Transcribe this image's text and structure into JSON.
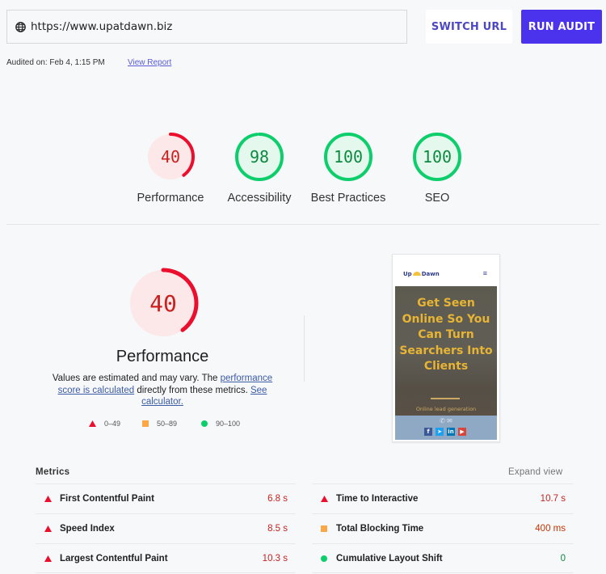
{
  "toolbar": {
    "url_value": "https://www.upatdawn.biz",
    "url_icon": "globe-icon",
    "switch_url_label": "SWITCH URL",
    "run_audit_label": "RUN AUDIT"
  },
  "audit_info": {
    "audited_on": "Audited on: Feb 4, 1:15 PM",
    "view_report_label": "View Report"
  },
  "colors": {
    "accent": "#4b33ee",
    "fail": "#eb0f2d",
    "average": "#fca746",
    "pass": "#0cce6b"
  },
  "categories": [
    {
      "label": "Performance",
      "score": 40,
      "status": "fail"
    },
    {
      "label": "Accessibility",
      "score": 98,
      "status": "pass"
    },
    {
      "label": "Best Practices",
      "score": 100,
      "status": "pass"
    },
    {
      "label": "SEO",
      "score": 100,
      "status": "pass"
    }
  ],
  "performance": {
    "score": 40,
    "title": "Performance",
    "desc_prefix": "Values are estimated and may vary. The ",
    "desc_link1": "performance score is calculated",
    "desc_middle": " directly from these metrics. ",
    "desc_link2": "See calculator.",
    "legend": [
      {
        "shape": "triangle",
        "range": "0–49"
      },
      {
        "shape": "square",
        "range": "50–89"
      },
      {
        "shape": "circle",
        "range": "90–100"
      }
    ]
  },
  "preview": {
    "logo_text_left": "Up",
    "logo_text_right": "Dawn",
    "menu_icon": "hamburger-icon",
    "headline": "Get Seen Online So You Can Turn Searchers Into Clients",
    "subheadline": "Online lead generation",
    "social": [
      "f",
      "t",
      "in",
      "yt"
    ]
  },
  "metrics": {
    "title": "Metrics",
    "expand_label": "Expand view",
    "left": [
      {
        "name": "First Contentful Paint",
        "value": "6.8 s",
        "status": "fail"
      },
      {
        "name": "Speed Index",
        "value": "8.5 s",
        "status": "fail"
      },
      {
        "name": "Largest Contentful Paint",
        "value": "10.3 s",
        "status": "fail"
      }
    ],
    "right": [
      {
        "name": "Time to Interactive",
        "value": "10.7 s",
        "status": "fail"
      },
      {
        "name": "Total Blocking Time",
        "value": "400 ms",
        "status": "average"
      },
      {
        "name": "Cumulative Layout Shift",
        "value": "0",
        "status": "pass"
      }
    ]
  }
}
